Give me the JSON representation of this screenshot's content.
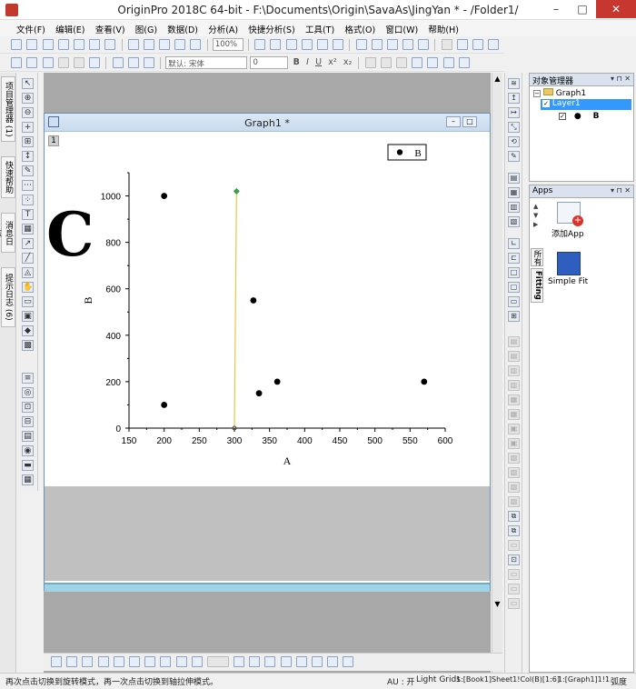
{
  "window": {
    "title": "OriginPro 2018C 64-bit - F:\\Documents\\Origin\\SavaAs\\JingYan * - /Folder1/"
  },
  "menu": [
    "文件(F)",
    "编辑(E)",
    "查看(V)",
    "图(G)",
    "数据(D)",
    "分析(A)",
    "快捷分析(S)",
    "工具(T)",
    "格式(O)",
    "窗口(W)",
    "帮助(H)"
  ],
  "toolbar": {
    "zoom": "100%",
    "font_name": "默认: 宋体",
    "font_size": "0",
    "bold": "B",
    "italic": "I",
    "underline": "U",
    "superscript": "x²",
    "subscript": "x₂"
  },
  "left_tabs": [
    "项目管理器 (1)",
    "快速帮助",
    "消息日志",
    "提示日志 (6)"
  ],
  "graph_window": {
    "title": "Graph1 *",
    "layer_number": "1",
    "annotation": "C"
  },
  "chart_data": {
    "type": "scatter",
    "xlabel": "A",
    "ylabel": "B",
    "xlim": [
      150,
      600
    ],
    "ylim": [
      0,
      1100
    ],
    "x_ticks": [
      "150",
      "200",
      "250",
      "300",
      "350",
      "400",
      "450",
      "500",
      "550",
      "600"
    ],
    "y_ticks": [
      "0",
      "200",
      "400",
      "600",
      "800",
      "1000"
    ],
    "series": [
      {
        "name": "B",
        "points": [
          [
            200,
            1000
          ],
          [
            200,
            100
          ],
          [
            327,
            550
          ],
          [
            335,
            150
          ],
          [
            361,
            200
          ],
          [
            570,
            200
          ]
        ]
      }
    ],
    "line_annotation": {
      "x1": 300,
      "y1": 0,
      "x2": 303,
      "y2": 1020,
      "color": "#e8c840"
    },
    "legend": {
      "label": "B",
      "position": "top-right"
    }
  },
  "object_manager": {
    "title": "对象管理器",
    "graph": "Graph1",
    "layer": "Layer1",
    "plot": "B"
  },
  "apps": {
    "title": "Apps",
    "items": [
      "添加App",
      "Simple Fit"
    ],
    "side_tabs": [
      "所有",
      "Fitting"
    ]
  },
  "status": {
    "hint": "再次点击切换到旋转模式，再一次点击切换到轴拉伸模式。",
    "au": "AU : 开",
    "grid": "Light Grids",
    "sheet": "1:[Book1]Sheet1!Col(B)[1:6]",
    "graph_ref": "1:[Graph1]1!1",
    "angle": "弧度"
  },
  "colors": {
    "accent": "#3399ff",
    "line": "#e8c840",
    "marker": "#000000"
  }
}
